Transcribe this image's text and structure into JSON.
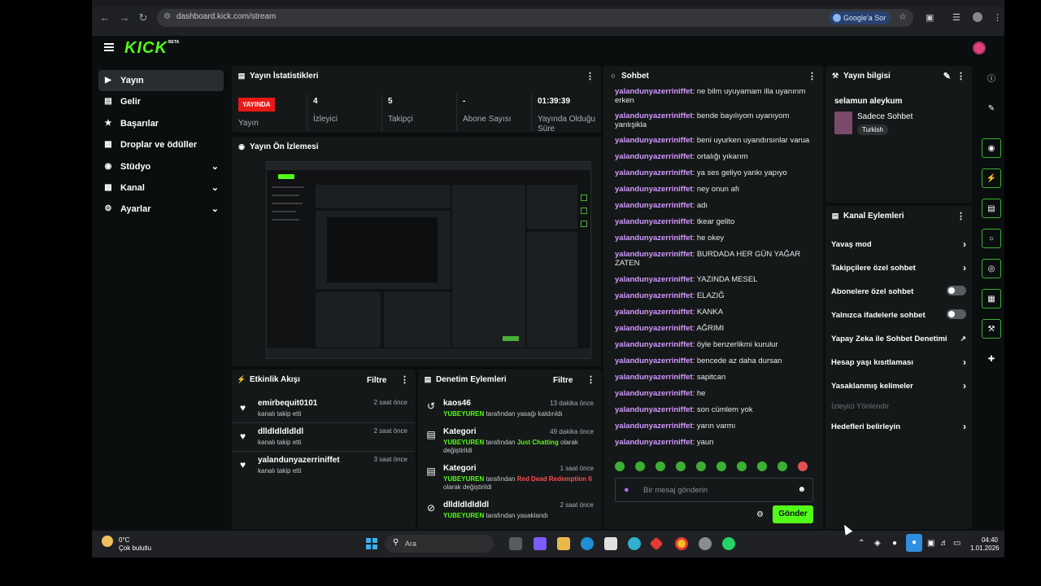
{
  "browser": {
    "url": "dashboard.kick.com/stream",
    "google_ask": "Google'a Sor"
  },
  "brand": {
    "logo": "KICK",
    "beta": "BETA"
  },
  "sidebar": {
    "items": [
      {
        "label": "Yayın",
        "icon": "video-icon"
      },
      {
        "label": "Gelir",
        "icon": "wallet-icon"
      },
      {
        "label": "Başarılar",
        "icon": "trophy-icon"
      },
      {
        "label": "Droplar ve ödüller",
        "icon": "gift-icon"
      },
      {
        "label": "Stüdyo",
        "icon": "studio-icon"
      },
      {
        "label": "Kanal",
        "icon": "channel-icon"
      },
      {
        "label": "Ayarlar",
        "icon": "gear-icon"
      }
    ]
  },
  "stats": {
    "title": "Yayın İstatistikleri",
    "live_badge": "YAYINDA",
    "items": [
      {
        "value": "",
        "label": "Yayın"
      },
      {
        "value": "4",
        "label": "İzleyici"
      },
      {
        "value": "5",
        "label": "Takipçi"
      },
      {
        "value": "-",
        "label": "Abone Sayısı"
      },
      {
        "value": "01:39:39",
        "label": "Yayında Olduğu Süre"
      }
    ]
  },
  "preview": {
    "title": "Yayın Ön İzlemesi"
  },
  "activity": {
    "title": "Etkinlik Akışı",
    "filter": "Filtre",
    "rows": [
      {
        "name": "emirbequit0101",
        "sub": "kanalı takip etti",
        "time": "2 saat önce"
      },
      {
        "name": "dlldldldldldl",
        "sub": "kanalı takip etti",
        "time": "2 saat önce"
      },
      {
        "name": "yalandunyazerriniffet",
        "sub": "kanalı takip etti",
        "time": "3 saat önce"
      }
    ]
  },
  "moderation": {
    "title": "Denetim Eylemleri",
    "filter": "Filtre",
    "rows": [
      {
        "title": "kaos46",
        "time": "13 dakika önce",
        "actor": "YUBEYUREN",
        "text1": " tarafından yasağı kaldırıldı",
        "highlight": "",
        "text2": ""
      },
      {
        "title": "Kategori",
        "time": "49 dakika önce",
        "actor": "YUBEYUREN",
        "text1": " tarafından ",
        "highlight": "Just Chatting",
        "text2": " olarak değiştirildi"
      },
      {
        "title": "Kategori",
        "time": "1 saat önce",
        "actor": "YUBEYUREN",
        "text1": " tarafından ",
        "highlight": "Red Dead Redemption II",
        "text2": " olarak değiştirildi"
      },
      {
        "title": "dlldldldldldl",
        "time": "2 saat önce",
        "actor": "YUBEYUREN",
        "text1": " tarafından yasaklandı",
        "highlight": "",
        "text2": ""
      }
    ]
  },
  "chat": {
    "title": "Sohbet",
    "user": "yalandunyazerriniffet",
    "messages": [
      "ne bilm uyuyamam illa uyanırım erken",
      "bende bayılıyom uyanıyom yanlışikla",
      "beni uyurken uyandırsınlar varua",
      "ortalığı yıkarım",
      "ya ses geliyo yankı yapıyo",
      "ney onun afı",
      "adı",
      "tkear gelito",
      "he okey",
      "BURDADA HER GÜN YAĞAR ZATEN",
      "YAZINDA MESEL",
      "ELAZIĞ",
      "KANKA",
      "AĞRIMI",
      "öyle benzerlikmi kurulur",
      "bencede az daha dursan",
      "sapitcan",
      "he",
      "son cümlem yok",
      "yarın varmı",
      "yaun"
    ],
    "placeholder": "Bir mesaj gönderin",
    "send": "Gönder"
  },
  "info": {
    "title": "Yayın bilgisi",
    "stream_title": "selamun aleykum",
    "category": "Sadece Sohbet",
    "tag": "Turkish"
  },
  "channel_actions": {
    "title": "Kanal Eylemleri",
    "rows": [
      {
        "label": "Yavaş mod",
        "type": "chevron"
      },
      {
        "label": "Takipçilere özel sohbet",
        "type": "chevron"
      },
      {
        "label": "Abonelere özel sohbet",
        "type": "toggle"
      },
      {
        "label": "Yalnızca ifadelerle sohbet",
        "type": "toggle"
      },
      {
        "label": "Yapay Zeka ile Sohbet Denetimi",
        "type": "chart"
      },
      {
        "label": "Hesap yaşı kısıtlaması",
        "type": "chevron"
      },
      {
        "label": "Yasaklanmış kelimeler",
        "type": "chevron"
      },
      {
        "label": "İzleyici Yönlendir",
        "type": "section"
      },
      {
        "label": "Hedefleri belirleyin",
        "type": "chevron"
      }
    ]
  },
  "taskbar": {
    "temp": "0°C",
    "weather": "Çok bulutlu",
    "search": "Ara",
    "time": "04:40",
    "date": "1.01.2026"
  }
}
